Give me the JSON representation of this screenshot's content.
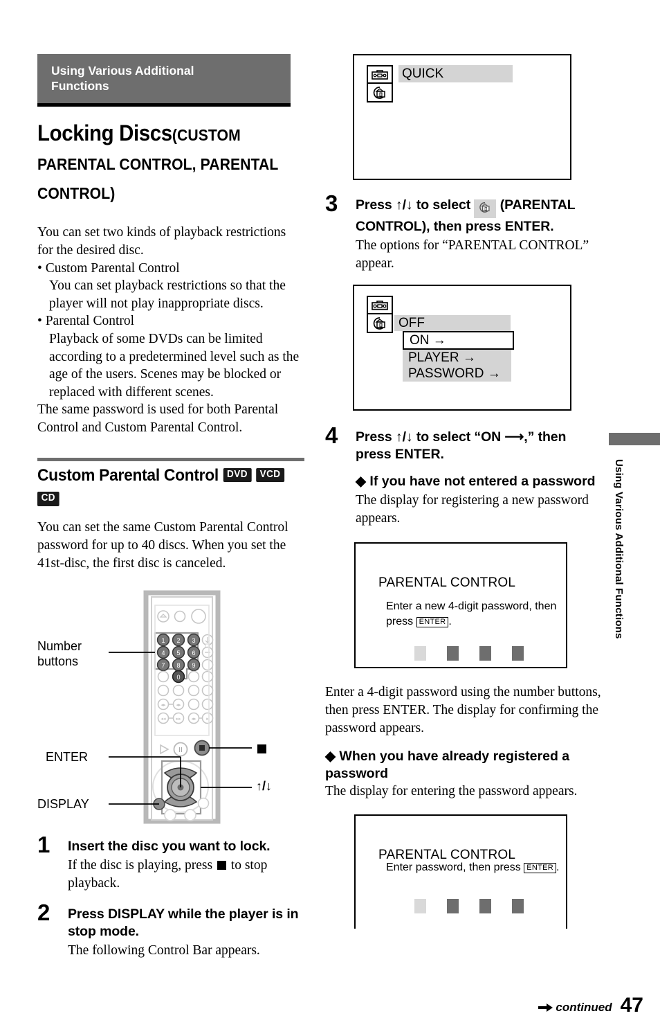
{
  "chapter": {
    "line1": "Using Various Additional",
    "line2": "Functions"
  },
  "title": {
    "main": "Locking Discs",
    "paren_line1": "(CUSTOM",
    "paren_line2": "PARENTAL CONTROL, PARENTAL",
    "paren_line3": "CONTROL)"
  },
  "intro": {
    "p1": "You can set two kinds of playback restrictions for the desired disc.",
    "bullet1_title": "• Custom Parental Control",
    "bullet1_body": "You can set playback restrictions so that the player will not play inappropriate discs.",
    "bullet2_title": "• Parental Control",
    "bullet2_body": "Playback of some DVDs can be limited according to a predetermined level such as the age of the users. Scenes may be blocked or replaced with different scenes.",
    "p2": "The same password is used for both Parental Control and Custom Parental Control."
  },
  "section": {
    "heading": "Custom Parental Control",
    "tags": [
      "DVD",
      "VCD",
      "CD"
    ],
    "body": "You can set the same Custom Parental Control password for up to 40 discs. When you set the 41st-disc, the first disc is canceled."
  },
  "remote": {
    "labels": {
      "number_buttons_line1": "Number",
      "number_buttons_line2": "buttons",
      "enter": "ENTER",
      "display": "DISPLAY",
      "stop_icon": "stop-square",
      "updown": "↑/↓"
    },
    "keys": [
      "1",
      "2",
      "3",
      "4",
      "5",
      "6",
      "7",
      "8",
      "9",
      "0"
    ]
  },
  "steps": [
    {
      "num": "1",
      "head": "Insert the disc you want to lock.",
      "body_pre": "If the disc is playing, press ",
      "body_post": " to stop playback."
    },
    {
      "num": "2",
      "head": "Press DISPLAY while the player is in stop mode.",
      "body": "The following Control Bar appears."
    },
    {
      "num": "3",
      "head_pre": "Press ↑/↓ to select ",
      "head_post": " (PARENTAL CONTROL), then press ENTER.",
      "body": "The options for “PARENTAL CONTROL” appear."
    },
    {
      "num": "4",
      "head": "Press ↑/↓ to select “ON ⟶,” then press ENTER.",
      "sub1_head": "◆ If you have not entered a password",
      "sub1_body": "The display for registering a new password appears.",
      "after_body": "Enter a 4-digit password using the number buttons, then press ENTER. The display for confirming the password appears.",
      "sub2_head": "◆ When you have already registered a password",
      "sub2_body": "The display for entering the password appears."
    }
  ],
  "osd": {
    "quick": {
      "label": "QUICK",
      "icon_top": "toolbox-icon",
      "icon_bottom": "parental-control-lock-icon"
    },
    "options": {
      "icon_top": "toolbox-icon",
      "icon_bottom": "parental-control-lock-icon",
      "current": "OFF",
      "items": [
        "ON →",
        "PLAYER →",
        "PASSWORD →"
      ],
      "selected": "ON →"
    },
    "new_password": {
      "title": "PARENTAL CONTROL",
      "instr_pre": "Enter a new 4-digit password, then press ",
      "enter_key": "ENTER",
      "instr_post": ".",
      "digits": 4
    },
    "enter_password": {
      "title": "PARENTAL CONTROL",
      "instr_pre": "Enter password, then press ",
      "enter_key": "ENTER",
      "instr_post": ".",
      "digits": 4
    }
  },
  "sidetab": {
    "text": "Using Various Additional Functions"
  },
  "footer": {
    "continued": "continued",
    "page": "47"
  },
  "colors": {
    "banner_gray": "#6e6e6e",
    "highlight_gray": "#d4d4d4",
    "tag_black": "#1a1a1a",
    "pw_filled": "#6e6e6e",
    "pw_first": "#d9d9d9"
  }
}
